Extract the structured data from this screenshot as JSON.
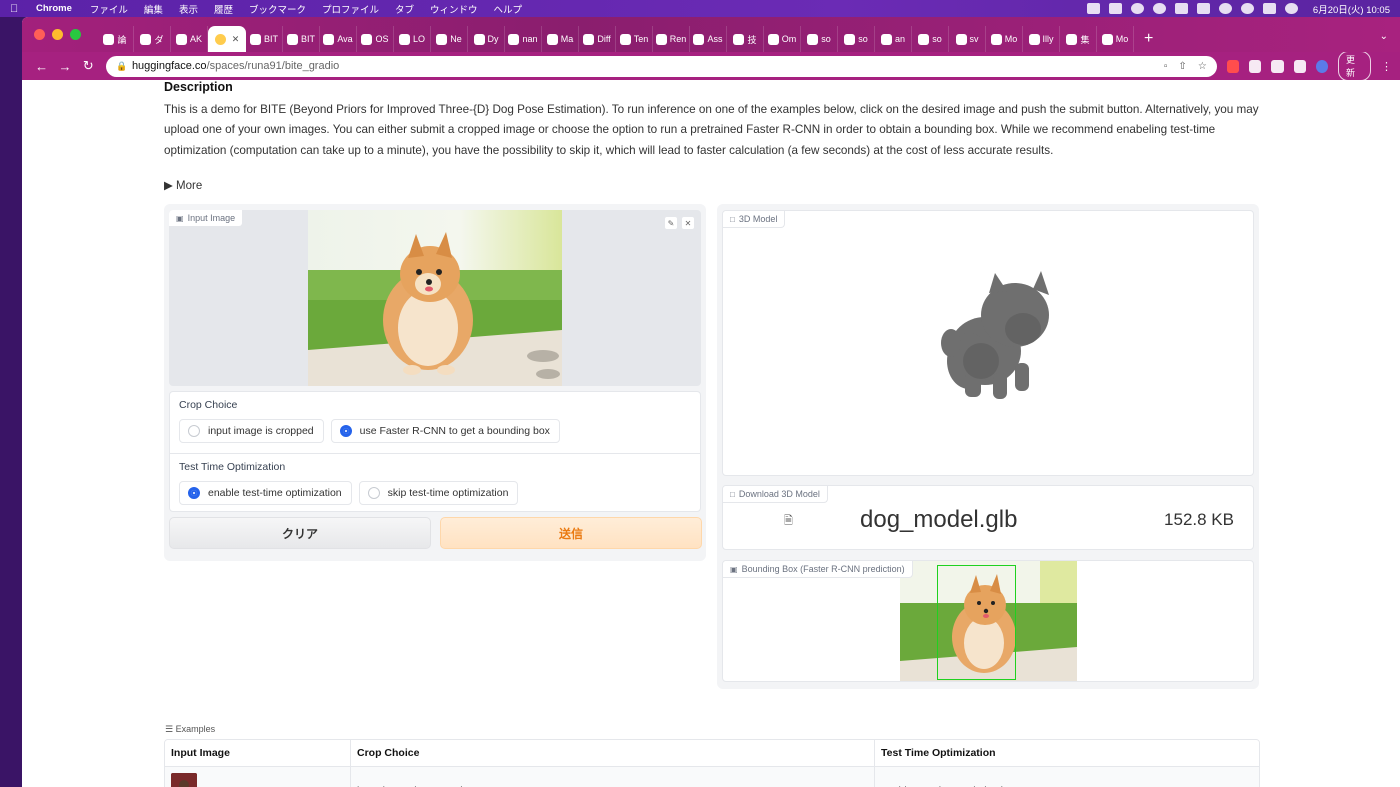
{
  "menubar": {
    "app_name": "Chrome",
    "menus": [
      "ファイル",
      "編集",
      "表示",
      "履歴",
      "ブックマーク",
      "プロファイル",
      "タブ",
      "ウィンドウ",
      "ヘルプ"
    ],
    "clock": "6月20日(火)  10:05"
  },
  "browser": {
    "tabs": [
      {
        "label": "論",
        "favicon": "hf-icon"
      },
      {
        "label": "ダ",
        "favicon": "notion-icon"
      },
      {
        "label": "AK",
        "favicon": "twitter-icon"
      },
      {
        "label": "",
        "favicon": "huggingface-icon",
        "active": true
      },
      {
        "label": "BIT",
        "favicon": "globe-icon"
      },
      {
        "label": "BIT",
        "favicon": "link-icon"
      },
      {
        "label": "Ava",
        "favicon": "ukraine-icon"
      },
      {
        "label": "OS",
        "favicon": "github-icon"
      },
      {
        "label": "LO",
        "favicon": "github-icon"
      },
      {
        "label": "Ne",
        "favicon": "globe-icon"
      },
      {
        "label": "Dy",
        "favicon": "globe-icon"
      },
      {
        "label": "nan",
        "favicon": "github-icon"
      },
      {
        "label": "Ma",
        "favicon": "globe-icon"
      },
      {
        "label": "Diff",
        "favicon": "image-icon"
      },
      {
        "label": "Ten",
        "favicon": "github-icon"
      },
      {
        "label": "Ren",
        "favicon": "huggingface-icon"
      },
      {
        "label": "Ass",
        "favicon": "a-icon"
      },
      {
        "label": "技",
        "favicon": "doc-icon"
      },
      {
        "label": "Om",
        "favicon": "image-icon"
      },
      {
        "label": "so",
        "favicon": "hf-icon"
      },
      {
        "label": "so",
        "favicon": "infinity-icon"
      },
      {
        "label": "an",
        "favicon": "infinity-icon"
      },
      {
        "label": "so",
        "favicon": "infinity-icon"
      },
      {
        "label": "sv",
        "favicon": "link-icon"
      },
      {
        "label": "Mo",
        "favicon": "huggingface-icon"
      },
      {
        "label": "Illy",
        "favicon": "huggingface-icon"
      },
      {
        "label": "集",
        "favicon": "green-icon"
      },
      {
        "label": "Mo",
        "favicon": "huggingface-icon"
      }
    ],
    "url_host": "huggingface.co",
    "url_path": "/spaces/runa91/bite_gradio",
    "update_label": "更新"
  },
  "page": {
    "description_heading": "Description",
    "description_text": "This is a demo for BITE (Beyond Priors for Improved Three-{D} Dog Pose Estimation). To run inference on one of the examples below, click on the desired image and push the submit button. Alternatively, you may upload one of your own images. You can either submit a cropped image or choose the option to run a pretrained Faster R-CNN in order to obtain a bounding box. While we recommend enabeling test-time optimization (computation can take up to a minute), you have the possibility to skip it, which will lead to faster calculation (a few seconds) at the cost of less accurate results.",
    "more_label": "More",
    "input_image_label": "Input Image",
    "crop_choice": {
      "label": "Crop Choice",
      "options": [
        "input image is cropped",
        "use Faster R-CNN to get a bounding box"
      ],
      "selected": 1
    },
    "tto": {
      "label": "Test Time Optimization",
      "options": [
        "enable test-time optimization",
        "skip test-time optimization"
      ],
      "selected": 0
    },
    "clear_button": "クリア",
    "submit_button": "送信",
    "model_label": "3D Model",
    "download_label": "Download 3D Model",
    "file_name": "dog_model.glb",
    "file_size": "152.8 KB",
    "bbox_label": "Bounding Box (Faster R-CNN prediction)",
    "examples_label": "Examples",
    "examples_table": {
      "headers": [
        "Input Image",
        "Crop Choice",
        "Test Time Optimization"
      ],
      "rows": [
        [
          "",
          "input image is cropped",
          "enable test-time optimization"
        ]
      ]
    }
  },
  "colors": {
    "accent_blue": "#2563eb",
    "submit_orange": "#ea7a12",
    "bbox_green": "#1fd11f"
  }
}
